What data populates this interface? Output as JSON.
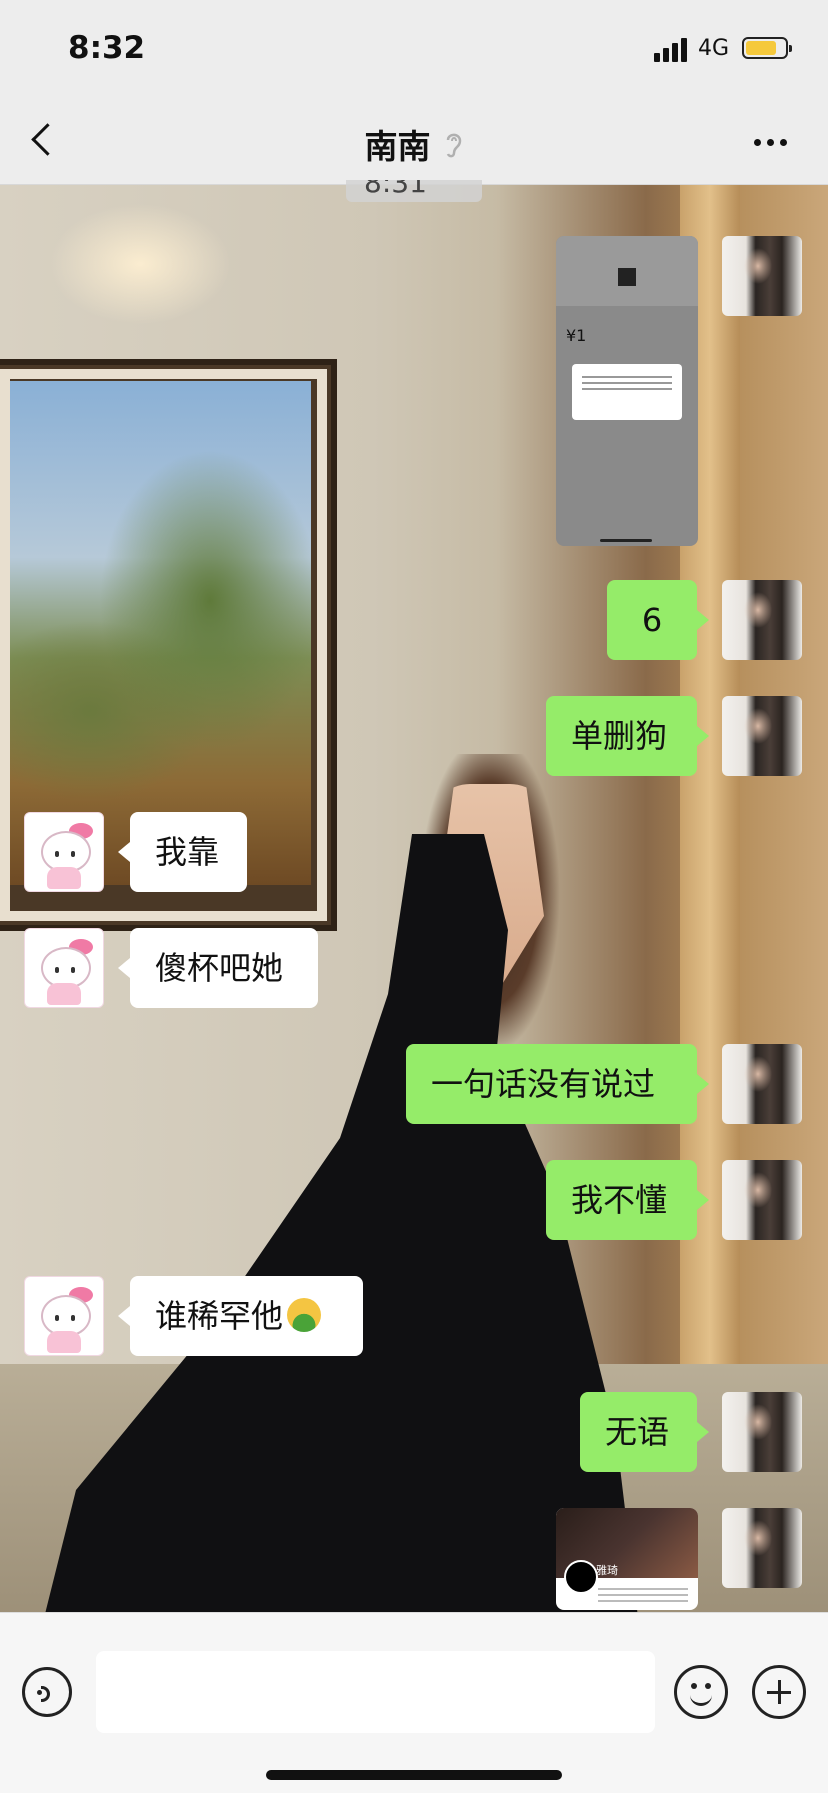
{
  "status_bar": {
    "time": "8:32",
    "network": "4G"
  },
  "nav": {
    "title": "南南"
  },
  "timestamp": "8:31",
  "messages": [
    {
      "side": "out",
      "type": "image",
      "desc": "payment-screenshot"
    },
    {
      "side": "out",
      "type": "text",
      "text": "6"
    },
    {
      "side": "out",
      "type": "text",
      "text": "单删狗"
    },
    {
      "side": "in",
      "type": "text",
      "text": "我靠"
    },
    {
      "side": "in",
      "type": "text",
      "text": "傻杯吧她"
    },
    {
      "side": "out",
      "type": "text",
      "text": "一句话没有说过"
    },
    {
      "side": "out",
      "type": "text",
      "text": "我不懂"
    },
    {
      "side": "in",
      "type": "text",
      "text": "谁稀罕他",
      "emoji": "vomiting-face"
    },
    {
      "side": "out",
      "type": "text",
      "text": "无语"
    },
    {
      "side": "out",
      "type": "image",
      "desc": "profile-screenshot"
    }
  ],
  "screenshot1": {
    "amount": "¥1"
  },
  "screenshot2": {
    "name": "雅琦"
  },
  "input": {
    "placeholder": ""
  },
  "colors": {
    "outgoing_bubble": "#95ec69",
    "incoming_bubble": "#ffffff",
    "battery": "#f5c93c"
  }
}
